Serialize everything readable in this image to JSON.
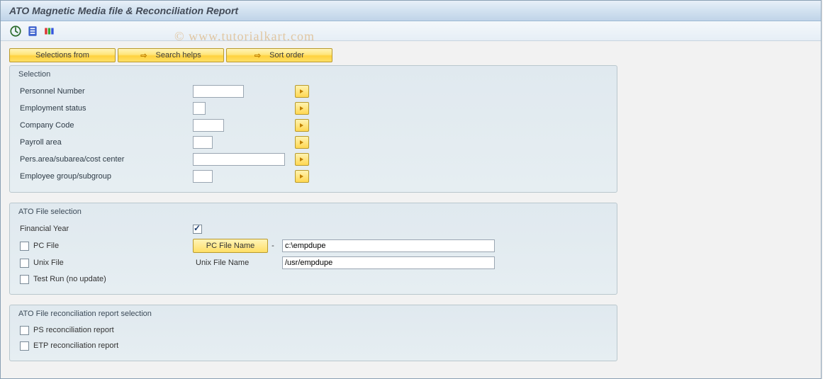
{
  "title": "ATO Magnetic Media file & Reconciliation Report",
  "watermark": "© www.tutorialkart.com",
  "toolbar_icons": {
    "execute": "execute",
    "info": "info",
    "colors": "colors"
  },
  "yellow_buttons": {
    "selections_from": "Selections from",
    "search_helps": "Search helps",
    "sort_order": "Sort order"
  },
  "groups": {
    "selection": {
      "title": "Selection",
      "fields": {
        "personnel_number": {
          "label": "Personnel Number",
          "value": "",
          "width": "72"
        },
        "employment_status": {
          "label": "Employment status",
          "value": "",
          "width": "18"
        },
        "company_code": {
          "label": "Company Code",
          "value": "",
          "width": "44"
        },
        "payroll_area": {
          "label": "Payroll area",
          "value": "",
          "width": "28"
        },
        "pers_area": {
          "label": "Pers.area/subarea/cost center",
          "value": "",
          "width": "130"
        },
        "employee_group": {
          "label": "Employee group/subgroup",
          "value": "",
          "width": "28"
        }
      }
    },
    "ato_file": {
      "title": "ATO File selection",
      "financial_year": {
        "label": "Financial Year",
        "checked": true
      },
      "pc_file": {
        "label": "PC File",
        "checked": false,
        "btn": "PC File Name",
        "sep": "-",
        "value": "c:\\empdupe"
      },
      "unix_file": {
        "label": "Unix File",
        "checked": false,
        "name_label": "Unix File Name",
        "value": "/usr/empdupe"
      },
      "test_run": {
        "label": "Test Run (no update)",
        "checked": false
      }
    },
    "recon": {
      "title": "ATO File reconciliation report selection",
      "ps": {
        "label": "PS reconciliation report",
        "checked": false
      },
      "etp": {
        "label": "ETP reconciliation report",
        "checked": false
      }
    }
  }
}
